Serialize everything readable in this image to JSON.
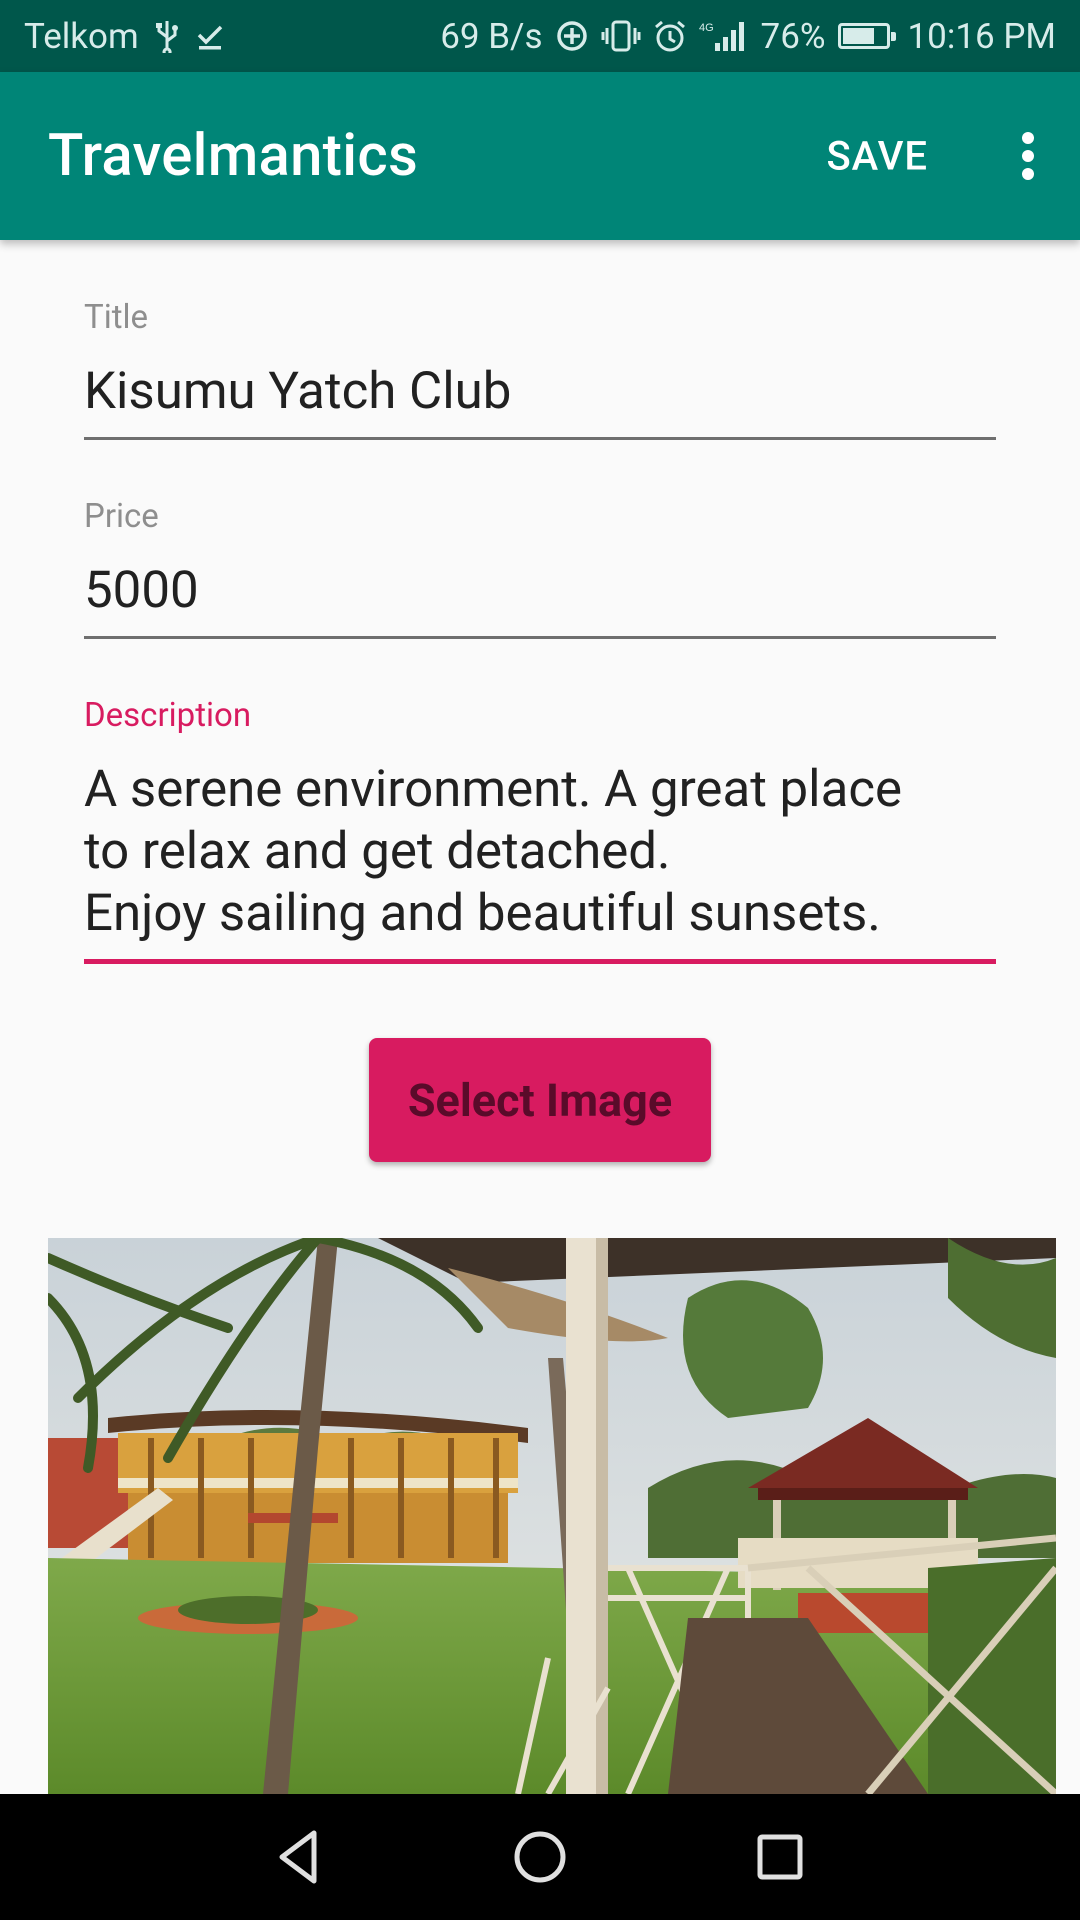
{
  "status_bar": {
    "carrier": "Telkom",
    "net_speed": "69 B/s",
    "network_type": "4G",
    "battery_percent": "76%",
    "battery_level": 0.76,
    "time": "10:16 PM",
    "icons": [
      "usb-icon",
      "download-done-icon",
      "data-saver-icon",
      "vibrate-icon",
      "alarm-icon",
      "signal-icon",
      "battery-charging-icon"
    ]
  },
  "app_bar": {
    "title": "Travelmantics",
    "save_label": "SAVE",
    "background": "#008577",
    "status_background": "#00574b"
  },
  "form": {
    "title": {
      "label": "Title",
      "value": "Kisumu Yatch Club"
    },
    "price": {
      "label": "Price",
      "value": "5000"
    },
    "description": {
      "label": "Description",
      "lines": [
        "A serene environment. A great place",
        "to relax and get detached.",
        "Enjoy sailing and beautiful sunsets."
      ]
    },
    "accent_color": "#d81b60"
  },
  "select_image_button": {
    "label": "Select Image"
  },
  "image": {
    "subject": "yacht club clubhouse with palm trees, lawn and gazebo"
  },
  "nav_bar": {
    "icons": [
      "back-icon",
      "home-icon",
      "recents-icon"
    ]
  }
}
